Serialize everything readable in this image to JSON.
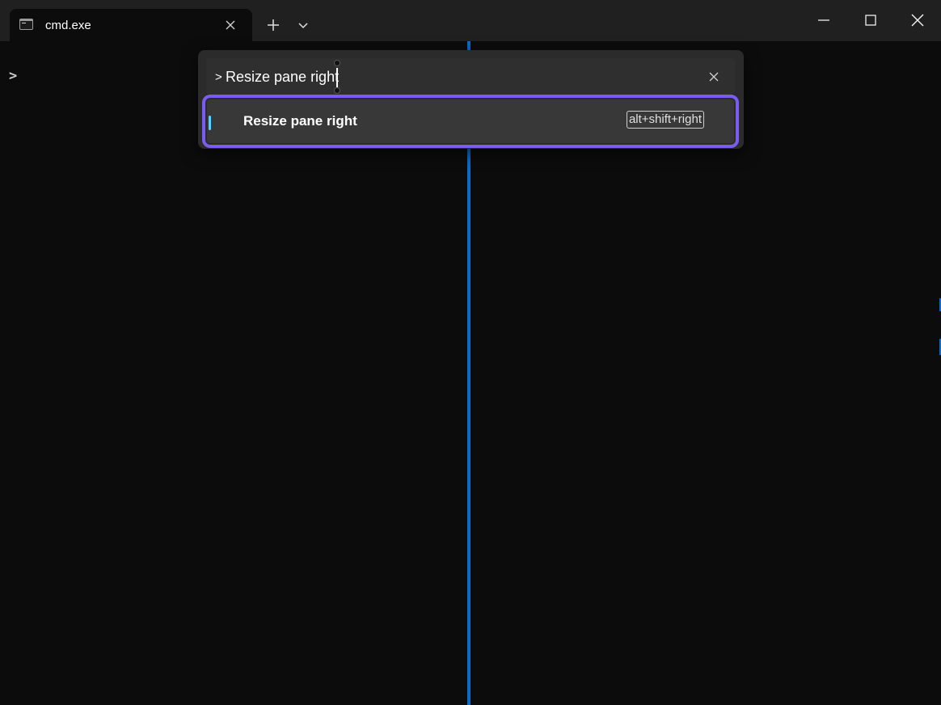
{
  "window": {
    "tab_title": "cmd.exe",
    "tab_icon": "console-icon",
    "accent_color": "#0e6bc7"
  },
  "terminal": {
    "prompt": ">"
  },
  "command_palette": {
    "prefix": ">",
    "search_value": "Resize pane right",
    "results": [
      {
        "label": "Resize pane right",
        "keychord": "alt+shift+right",
        "selected": true
      }
    ],
    "highlight_color": "#7b5cf0",
    "selection_color": "#60cdff"
  }
}
